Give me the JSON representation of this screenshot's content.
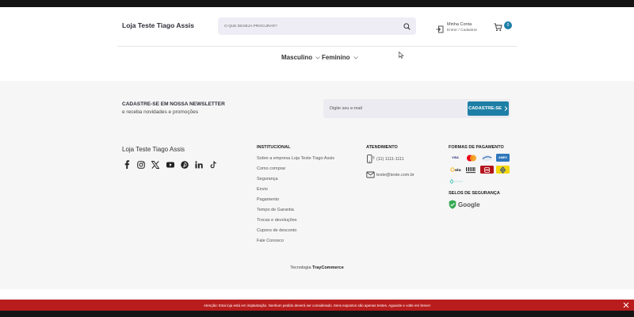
{
  "header": {
    "store_name": "Loja Teste Tiago Assis",
    "search_placeholder": "O QUE DESEJA PROCURAR?",
    "account_title": "Minha Conta",
    "account_sub": "Entrar / Cadastrar",
    "cart_count": "0"
  },
  "nav": {
    "items": [
      {
        "label": "Masculino"
      },
      {
        "label": "Feminino"
      }
    ]
  },
  "newsletter": {
    "title": "CADASTRE-SE EM NOSSA NEWSLETTER",
    "subtitle": "e receba novidades e promoções",
    "placeholder": "Digite seu e-mail",
    "button": "CADASTRE-SE"
  },
  "footer": {
    "store_name": "Loja Teste Tiago Assis",
    "socials": [
      "facebook-icon",
      "instagram-icon",
      "x-icon",
      "youtube-icon",
      "pinterest-icon",
      "linkedin-icon",
      "tiktok-icon"
    ],
    "institucional_title": "INSTITUCIONAL",
    "institucional_links": [
      "Sobre a empresa Loja Teste Tiago Assis",
      "Como comprar",
      "Segurança",
      "Envio",
      "Pagamento",
      "Tempo de Garantia",
      "Trocas e devoluções",
      "Cupons de desconto",
      "Fale Conosco"
    ],
    "atendimento_title": "ATENDIMENTO",
    "phone": "(11) 1111-1111",
    "email": "teste@teste.com.br",
    "pagamento_title": "FORMAS DE PAGAMENTO",
    "payment_cards": [
      "VISA",
      "mastercard",
      "diners",
      "AMEX",
      "elo",
      "boleto",
      "hipercard",
      "pix",
      "pagseguro"
    ],
    "seguranca_title": "SELOS DE SEGURANÇA",
    "seal": "Google",
    "powered_prefix": "Tecnologia",
    "powered_brand": "TrayCommerce"
  },
  "alert": {
    "text": "Atenção: Esta loja está em implantação. Nenhum pedido deverá ser considerado. Itens expostos são apenas testes. Aguarde e volte em breve!"
  },
  "colors": {
    "accent": "#1e7fa6",
    "alert_bg": "#b91c1c",
    "search_bg": "#eeedf5"
  }
}
